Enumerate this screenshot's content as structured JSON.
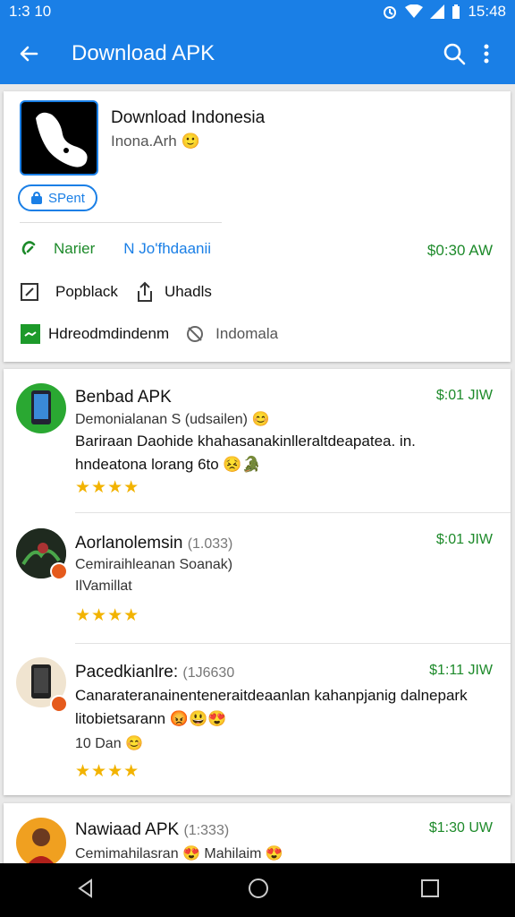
{
  "status_bar": {
    "time": "1:3 10",
    "clock": "15:48"
  },
  "app_bar": {
    "title": "Download APK"
  },
  "app": {
    "name": "Download Indonesia",
    "developer": "Inona.Arh",
    "chip_label": "SPent",
    "meta1_left": "Narier",
    "meta1_mid": "N Jo'fhdaanii",
    "meta1_price": "$0:30 AW",
    "meta2_a": "Popblack",
    "meta2_b": "Uhadls",
    "meta3_a": "Hdreodmdindenm",
    "meta3_b": "Indomala"
  },
  "reviews": [
    {
      "title": "Benbad APK",
      "count": "",
      "price": "$:01 JIW",
      "sub": "Demonialanan S (udsailen) 😊",
      "body": "Bariraan Daohide khahasanakinlleraltdeapatea. in. hndeatona lorang 6to 😣🐊",
      "stars": "★★★★",
      "avatar_color": "#2aa832"
    },
    {
      "title": "Aorlanolemsin",
      "count": "(1.033)",
      "price": "$:01 JIW",
      "sub": "Cemiraihleanan Soanak)",
      "body": "IlVamillat",
      "stars": "★★★★",
      "avatar_color": "#2b3a2b"
    },
    {
      "title": "Pacedkianlre:",
      "count": "(1J6630",
      "price": "$1:11 JIW",
      "sub": "",
      "body": "Canarateranainenteneraitdeaanlan kahanpjanig dalnepark litobietsarann 😡😃😍",
      "extra": "10 Dan 😊",
      "stars": "★★★★",
      "avatar_color": "#f0e4d0"
    },
    {
      "title": "Nawiaad APK",
      "count": "(1:333)",
      "price": "$1:30 UW",
      "sub": "Cemimahilasran 😍 Mahilaim 😍",
      "avatar_color": "#f0a020"
    }
  ],
  "colors": {
    "primary": "#1a7fe6",
    "price_green": "#1d8a2a",
    "star": "#f2b300"
  }
}
